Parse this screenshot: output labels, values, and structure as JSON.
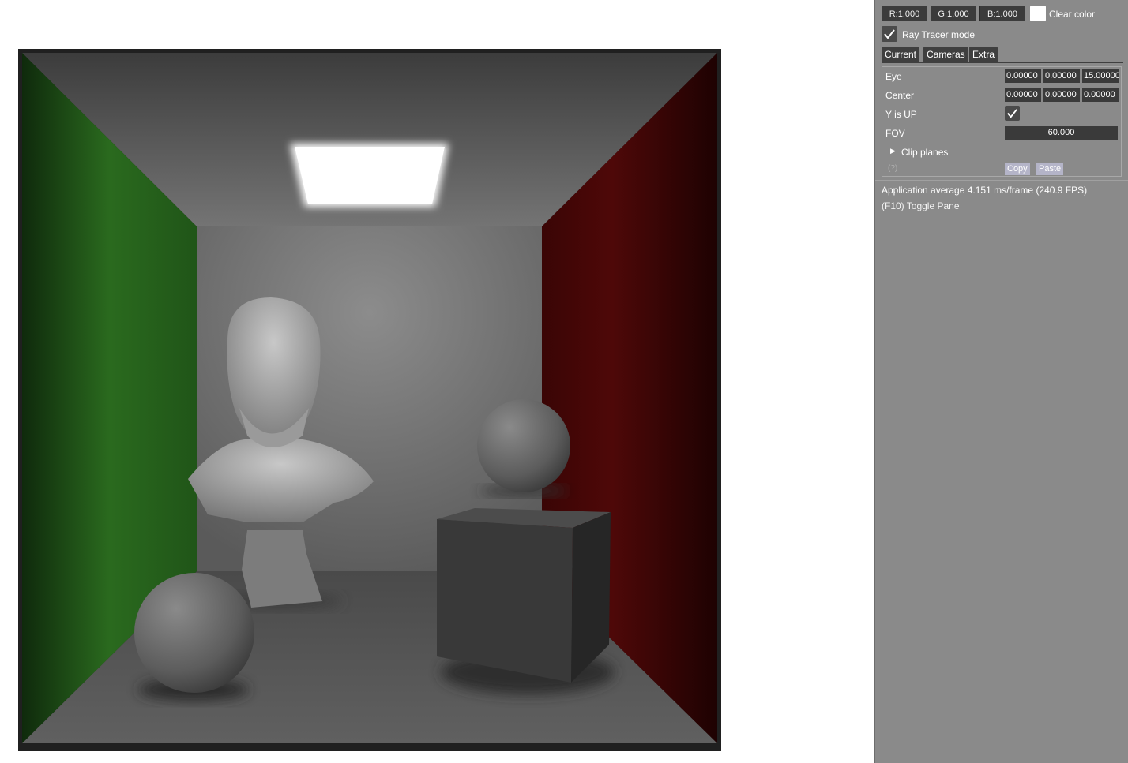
{
  "clear_color": {
    "r_label": "R:1.000",
    "g_label": "G:1.000",
    "b_label": "B:1.000",
    "swatch_color": "#ffffff",
    "label": "Clear color"
  },
  "ray_tracer": {
    "label": "Ray Tracer mode",
    "checked": true
  },
  "tabs": [
    {
      "label": "Current",
      "active": true
    },
    {
      "label": "Cameras",
      "active": false
    },
    {
      "label": "Extra",
      "active": false
    }
  ],
  "camera": {
    "eye_label": "Eye",
    "eye": [
      "0.00000",
      "0.00000",
      "15.00000"
    ],
    "center_label": "Center",
    "center": [
      "0.00000",
      "0.00000",
      "0.00000"
    ],
    "y_up_label": "Y is UP",
    "y_up_checked": true,
    "fov_label": "FOV",
    "fov_value": "60.000",
    "clip_planes_label": "Clip planes",
    "help_label": "(?)",
    "copy_label": "Copy",
    "paste_label": "Paste"
  },
  "stats": {
    "average": "Application average 4.151 ms/frame (240.9 FPS)",
    "toggle_hint": "(F10) Toggle Pane"
  },
  "scene_colors": {
    "left_wall": "#2a6a1e",
    "right_wall": "#4a0606",
    "walls": "#7a7a7a",
    "light": "#ffffff"
  }
}
